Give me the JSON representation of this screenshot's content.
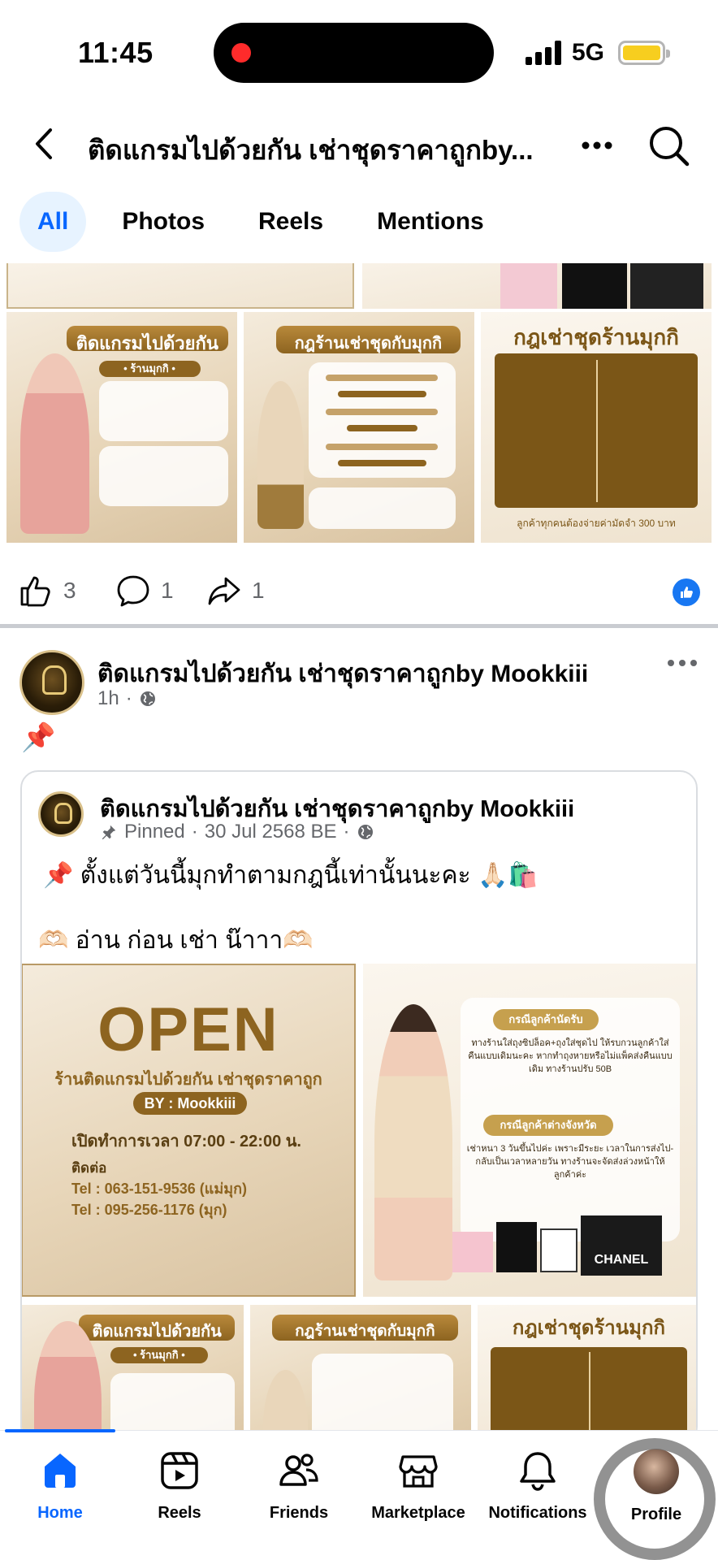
{
  "status_bar": {
    "time": "11:45",
    "network": "5G"
  },
  "header": {
    "title": "ติดแกรมไปด้วยกัน เช่าชุดราคาถูกby..."
  },
  "tabs": [
    {
      "label": "All",
      "active": true
    },
    {
      "label": "Photos",
      "active": false
    },
    {
      "label": "Reels",
      "active": false
    },
    {
      "label": "Mentions",
      "active": false
    }
  ],
  "prev_post": {
    "images": [
      {
        "title": "ติดแกรมไปด้วยกัน",
        "subtitle": "• ร้านมุกกิ •"
      },
      {
        "title": "กฎร้านเช่าชุดกับมุกกิ"
      },
      {
        "title": "กฎเช่าชุดร้านมุกกิ",
        "footer": "ลูกค้าทุกคนต้องจ่ายค่ามัดจำ 300 บาท"
      }
    ],
    "likes": "3",
    "comments": "1",
    "shares": "1"
  },
  "post": {
    "author": "ติดแกรมไปด้วยกัน เช่าชุดราคาถูกby Mookkiii",
    "time": "1h",
    "text": "📌",
    "shared": {
      "author": "ติดแกรมไปด้วยกัน เช่าชุดราคาถูกby Mookkiii",
      "pinned_label": "Pinned",
      "date": "30 Jul 2568 BE",
      "line1": "📌 ตั้งแต่วันนี้มุกทำตามกฎนี้เท่านั้นนะคะ 🙏🏻🛍️",
      "line2": "🫶🏻 อ่าน ก่อน เช่า น๊าาา🫶🏻",
      "open_poster": {
        "title": "OPEN",
        "shop": "ร้านติดแกรมไปด้วยกัน เช่าชุดราคาถูก",
        "by": "BY : Mookkiii",
        "hours": "เปิดทำการเวลา 07:00 - 22:00 น.",
        "contact": "ติดต่อ",
        "tel1": "Tel : 063-151-9536 (แม่มุก)",
        "tel2": "Tel : 095-256-1176 (มุก)"
      },
      "rules_poster": {
        "badge1": "กรณีลูกค้านัดรับ",
        "text1": "ทางร้านใส่ถุงซิปล็อค+ถุงใส่ชุดไป ให้รบกวนลูกค้าใส่คืนแบบเดิมนะคะ หากทำถุงหายหรือไม่แพ็คส่งคืนแบบเดิม ทางร้านปรับ 50B",
        "badge2": "กรณีลูกค้าต่างจังหวัด",
        "text2": "เช่าหนา 3 วันขึ้นไปค่ะ เพราะมีระยะ เวลาในการส่งไป-กลับเป็นเวลาหลายวัน ทางร้านจะจัดส่งล่วงหน้าให้ลูกค้าค่ะ",
        "bag_brand": "CHANEL"
      }
    }
  },
  "bottom_nav": [
    {
      "label": "Home",
      "icon": "home-icon",
      "active": true
    },
    {
      "label": "Reels",
      "icon": "reels-icon",
      "active": false
    },
    {
      "label": "Friends",
      "icon": "friends-icon",
      "active": false
    },
    {
      "label": "Marketplace",
      "icon": "marketplace-icon",
      "active": false
    },
    {
      "label": "Notifications",
      "icon": "bell-icon",
      "active": false
    },
    {
      "label": "Profile",
      "icon": "profile-avatar",
      "active": false
    }
  ],
  "colors": {
    "accent": "#0866ff",
    "like": "#1877f2",
    "gold": "#8d6420",
    "active_tab_bg": "#e7f3ff"
  }
}
